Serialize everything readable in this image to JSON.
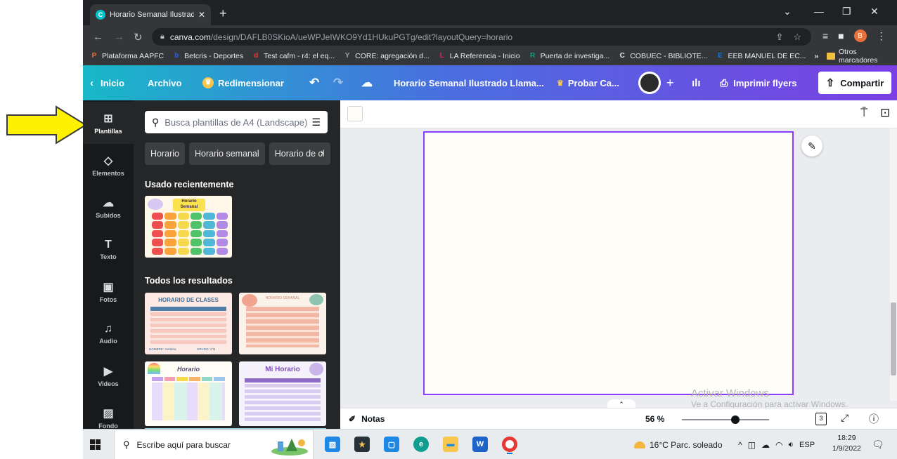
{
  "browser": {
    "tab_title": "Horario Semanal Ilustrado Llama",
    "tab_favicon": "C",
    "url_host": "canva.com",
    "url_path": "/design/DAFLB0SKioA/ueWPJeIWKO9Yd1HUkuPGTg/edit?layoutQuery=horario",
    "profile_initial": "B",
    "bookmarks": [
      {
        "label": "Plataforma AAPFC",
        "icon": "P",
        "color": "#e8713c"
      },
      {
        "label": "Betcris - Deportes",
        "icon": "b",
        "color": "#1e5eff"
      },
      {
        "label": "Test cafm - r4: el eq...",
        "icon": "d",
        "color": "#e53935"
      },
      {
        "label": "CORE: agregación d...",
        "icon": "Y",
        "color": "#9aa0a6"
      },
      {
        "label": "LA Referencia - Inicio",
        "icon": "L",
        "color": "#e91e63"
      },
      {
        "label": "Puerta de investiga...",
        "icon": "R",
        "color": "#00a77f"
      },
      {
        "label": "COBUEC - BIBLIOTE...",
        "icon": "C",
        "color": "#e8eaed"
      },
      {
        "label": "EEB MANUEL DE EC...",
        "icon": "E",
        "color": "#1976d2"
      }
    ],
    "bookmarks_more": "»",
    "bookmarks_folder": "Otros marcadores"
  },
  "canva": {
    "home": "Inicio",
    "file": "Archivo",
    "resize": "Redimensionar",
    "design_title": "Horario Semanal Ilustrado Llama...",
    "try_pro": "Probar Ca...",
    "print": "Imprimir flyers",
    "share": "Compartir",
    "accent": "#8b3dff"
  },
  "sidebar": {
    "items": [
      {
        "label": "Plantillas",
        "icon": "templates-icon"
      },
      {
        "label": "Elementos",
        "icon": "elements-icon"
      },
      {
        "label": "Subidos",
        "icon": "upload-icon"
      },
      {
        "label": "Texto",
        "icon": "text-icon"
      },
      {
        "label": "Fotos",
        "icon": "photos-icon"
      },
      {
        "label": "Audio",
        "icon": "audio-icon"
      },
      {
        "label": "Videos",
        "icon": "videos-icon"
      },
      {
        "label": "Fondo",
        "icon": "background-icon"
      }
    ]
  },
  "panel": {
    "search_placeholder": "Busca plantillas de A4 (Landscape)",
    "chips": [
      "Horario",
      "Horario semanal",
      "Horario de cl"
    ],
    "recent_title": "Usado recientemente",
    "all_title": "Todos los resultados",
    "recent_thumb": {
      "title_line1": "Horario",
      "title_line2": "Semanal"
    },
    "templates": [
      {
        "title": "HORARIO DE CLASES",
        "footer_left": "NOMBRE: Jordana",
        "footer_right": "GRADO: 2°B"
      },
      {
        "title": "HORARIO SEMANAL"
      },
      {
        "title": "Horario"
      },
      {
        "title": "Mi Horario"
      }
    ]
  },
  "editor": {
    "notes": "Notas",
    "zoom": "56 %",
    "zoom_level": 0.56,
    "page_count": "3",
    "watermark_line1": "Activar Windows",
    "watermark_line2": "Ve a Configuración para activar Windows."
  },
  "taskbar": {
    "search_placeholder": "Escribe aquí para buscar",
    "weather": "16°C  Parc. soleado",
    "language": "ESP",
    "time": "18:29",
    "date": "1/9/2022"
  }
}
